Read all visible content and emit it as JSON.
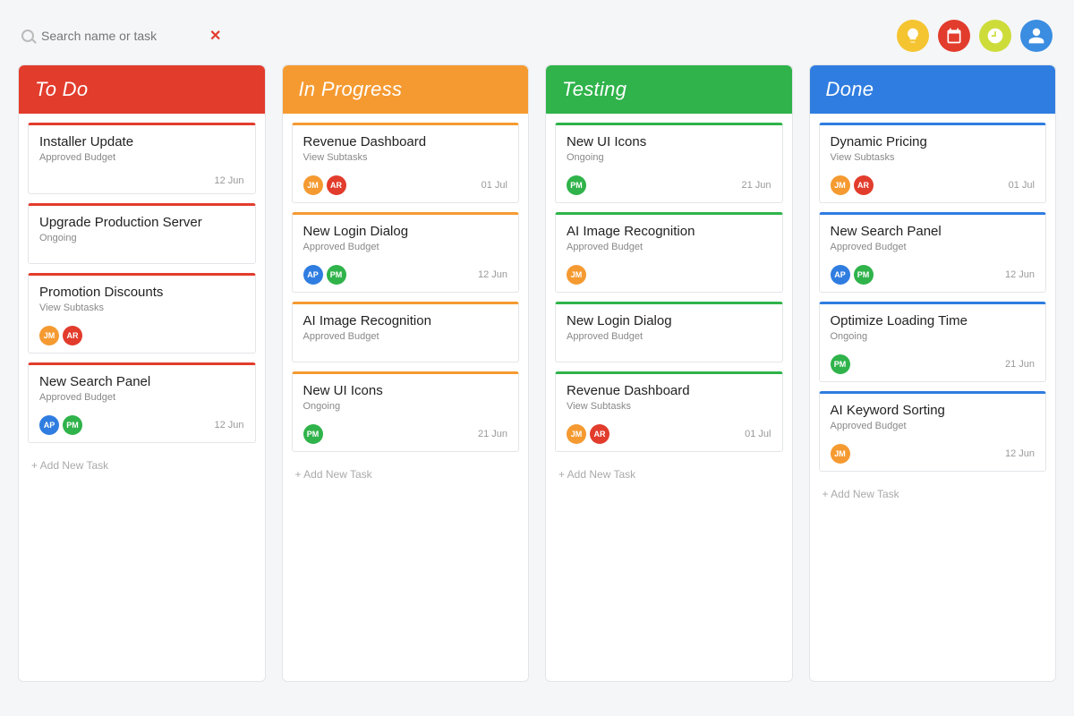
{
  "search": {
    "placeholder": "Search name or task",
    "clear": "✕"
  },
  "topIcons": [
    "bulb-icon",
    "calendar-icon",
    "clock-icon",
    "user-icon"
  ],
  "addTaskLabel": "+ Add New Task",
  "avatarColors": {
    "JM": "orange",
    "AR": "red",
    "AP": "blue",
    "PM": "green"
  },
  "columns": [
    {
      "name": "To Do",
      "headerColor": "#e23c2c",
      "accent": "#e23c2c",
      "cards": [
        {
          "title": "Installer Update",
          "sub": "Approved Budget",
          "avatars": [],
          "date": "12 Jun"
        },
        {
          "title": "Upgrade Production Server",
          "sub": "Ongoing",
          "avatars": [],
          "date": ""
        },
        {
          "title": "Promotion Discounts",
          "sub": "View Subtasks",
          "avatars": [
            "JM",
            "AR"
          ],
          "date": ""
        },
        {
          "title": "New Search Panel",
          "sub": "Approved Budget",
          "avatars": [
            "AP",
            "PM"
          ],
          "date": "12 Jun"
        }
      ]
    },
    {
      "name": "In Progress",
      "headerColor": "#f59a31",
      "accent": "#f59a31",
      "cards": [
        {
          "title": "Revenue Dashboard",
          "sub": "View Subtasks",
          "avatars": [
            "JM",
            "AR"
          ],
          "date": "01 Jul"
        },
        {
          "title": "New Login Dialog",
          "sub": "Approved Budget",
          "avatars": [
            "AP",
            "PM"
          ],
          "date": "12 Jun"
        },
        {
          "title": "AI Image Recognition",
          "sub": "Approved Budget",
          "avatars": [],
          "date": ""
        },
        {
          "title": "New UI Icons",
          "sub": "Ongoing",
          "avatars": [
            "PM"
          ],
          "date": "21 Jun"
        }
      ]
    },
    {
      "name": "Testing",
      "headerColor": "#2fb34a",
      "accent": "#2fb34a",
      "cards": [
        {
          "title": "New UI Icons",
          "sub": "Ongoing",
          "avatars": [
            "PM"
          ],
          "date": "21 Jun"
        },
        {
          "title": "AI Image Recognition",
          "sub": "Approved Budget",
          "avatars": [
            "JM"
          ],
          "date": ""
        },
        {
          "title": "New Login Dialog",
          "sub": "Approved Budget",
          "avatars": [],
          "date": ""
        },
        {
          "title": "Revenue Dashboard",
          "sub": "View Subtasks",
          "avatars": [
            "JM",
            "AR"
          ],
          "date": "01 Jul"
        }
      ]
    },
    {
      "name": "Done",
      "headerColor": "#2f7de0",
      "accent": "#2f7de0",
      "cards": [
        {
          "title": "Dynamic Pricing",
          "sub": "View Subtasks",
          "avatars": [
            "JM",
            "AR"
          ],
          "date": "01 Jul"
        },
        {
          "title": "New Search Panel",
          "sub": "Approved Budget",
          "avatars": [
            "AP",
            "PM"
          ],
          "date": "12 Jun"
        },
        {
          "title": "Optimize Loading Time",
          "sub": "Ongoing",
          "avatars": [
            "PM"
          ],
          "date": "21 Jun"
        },
        {
          "title": "AI Keyword Sorting",
          "sub": "Approved Budget",
          "avatars": [
            "JM"
          ],
          "date": "12 Jun"
        }
      ]
    }
  ]
}
